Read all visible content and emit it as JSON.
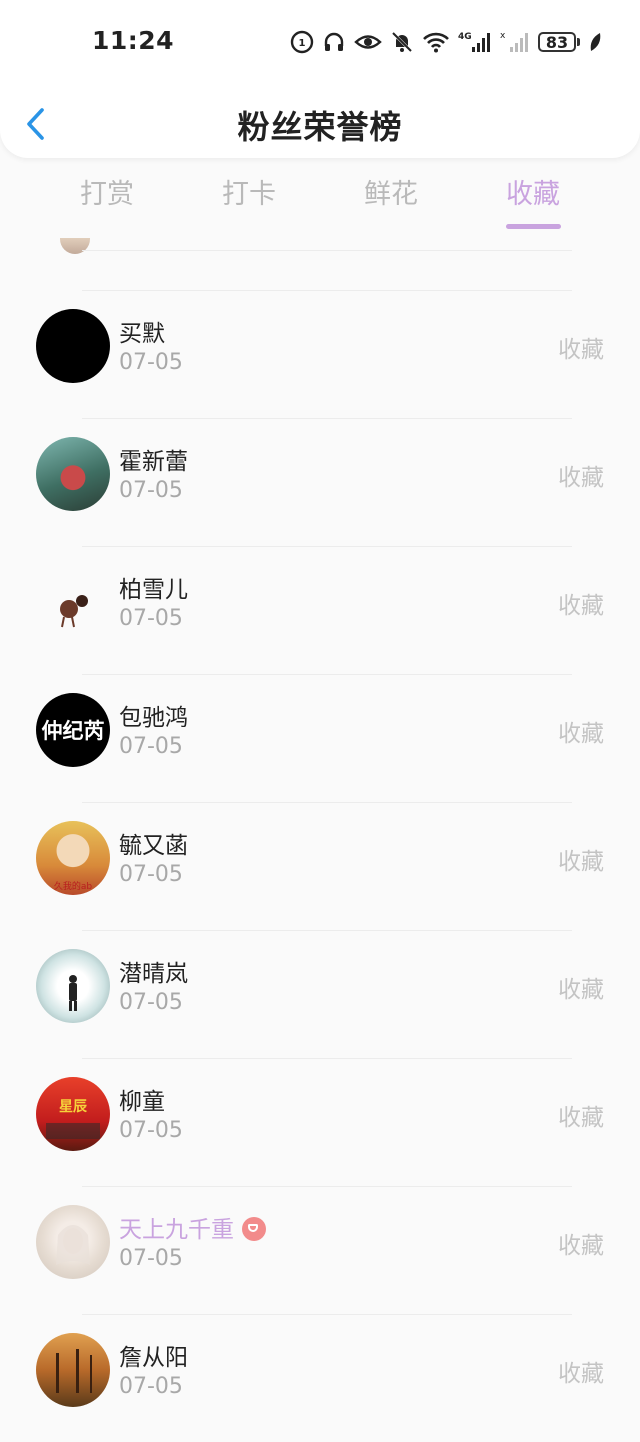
{
  "status_bar": {
    "time": "11:24",
    "battery": "83",
    "icons": [
      "hd-icon",
      "headphones-icon",
      "eye-icon",
      "mute-icon",
      "wifi-icon",
      "signal-4g-icon",
      "signal-icon",
      "battery-icon",
      "leaf-icon"
    ]
  },
  "nav": {
    "title": "粉丝荣誉榜",
    "back_icon": "back-chevron-icon"
  },
  "tabs": [
    {
      "label": "打赏",
      "active": false
    },
    {
      "label": "打卡",
      "active": false
    },
    {
      "label": "鲜花",
      "active": false
    },
    {
      "label": "收藏",
      "active": true
    }
  ],
  "colors": {
    "accent": "#c9a3df",
    "muted": "#b9b9b9",
    "vip_badge": "#f28b8b"
  },
  "list": [
    {
      "name": "买默",
      "date": "07-05",
      "action": "收藏"
    },
    {
      "name": "霍新蕾",
      "date": "07-05",
      "action": "收藏"
    },
    {
      "name": "柏雪儿",
      "date": "07-05",
      "action": "收藏"
    },
    {
      "name": "包驰鸿",
      "date": "07-05",
      "action": "收藏"
    },
    {
      "name": "毓又菡",
      "date": "07-05",
      "action": "收藏"
    },
    {
      "name": "潜晴岚",
      "date": "07-05",
      "action": "收藏"
    },
    {
      "name": "柳童",
      "date": "07-05",
      "action": "收藏"
    },
    {
      "name": "天上九千重",
      "date": "07-05",
      "action": "收藏",
      "vip": true
    },
    {
      "name": "詹从阳",
      "date": "07-05",
      "action": "收藏"
    }
  ],
  "avatars": {
    "av3_text": "仲纪芮",
    "av4_text": "久我的ab",
    "av6_text": "星辰"
  }
}
